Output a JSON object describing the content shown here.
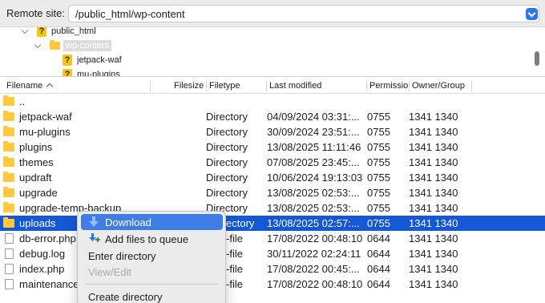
{
  "remote_site": {
    "label": "Remote site:",
    "path": "/public_html/wp-content"
  },
  "tree": {
    "items": [
      {
        "label": "public_html"
      },
      {
        "label": "wp-content"
      },
      {
        "label": "jetpack-waf"
      },
      {
        "label": "mu-plugins"
      }
    ]
  },
  "columns": {
    "filename": "Filename",
    "filesize": "Filesize",
    "filetype": "Filetype",
    "last_modified": "Last modified",
    "permissions": "Permissio",
    "owner_group": "Owner/Group"
  },
  "files": [
    {
      "name": "..",
      "type": "",
      "modified": "",
      "perm": "",
      "owner": ""
    },
    {
      "name": "jetpack-waf",
      "type": "Directory",
      "modified": "04/09/2024 03:31:...",
      "perm": "0755",
      "owner": "1341 1340"
    },
    {
      "name": "mu-plugins",
      "type": "Directory",
      "modified": "30/09/2024 23:51:...",
      "perm": "0755",
      "owner": "1341 1340"
    },
    {
      "name": "plugins",
      "type": "Directory",
      "modified": "13/08/2025 11:11:46",
      "perm": "0755",
      "owner": "1341 1340"
    },
    {
      "name": "themes",
      "type": "Directory",
      "modified": "07/08/2025 23:45:...",
      "perm": "0755",
      "owner": "1341 1340"
    },
    {
      "name": "updraft",
      "type": "Directory",
      "modified": "10/06/2024 19:13:03",
      "perm": "0755",
      "owner": "1341 1340"
    },
    {
      "name": "upgrade",
      "type": "Directory",
      "modified": "13/08/2025 02:53:...",
      "perm": "0755",
      "owner": "1341 1340"
    },
    {
      "name": "upgrade-temp-backup",
      "type": "Directory",
      "modified": "13/08/2025 02:53:...",
      "perm": "0755",
      "owner": "1341 1340"
    },
    {
      "name": "uploads",
      "type": "ectory",
      "modified": "13/08/2025 02:57:...",
      "perm": "0755",
      "owner": "1341 1340"
    },
    {
      "name": "db-error.php",
      "type": "-file",
      "modified": "17/08/2022 00:48:10",
      "perm": "0644",
      "owner": "1341 1340"
    },
    {
      "name": "debug.log",
      "type": "-file",
      "modified": "30/11/2022 02:24:11",
      "perm": "0644",
      "owner": "1341 1340"
    },
    {
      "name": "index.php",
      "type": "-file",
      "modified": "17/08/2022 00:45:...",
      "perm": "0644",
      "owner": "1341 1340"
    },
    {
      "name": "maintenance",
      "type": "-file",
      "modified": "17/08/2022 00:48:10",
      "perm": "0644",
      "owner": "1341 1340"
    }
  ],
  "context_menu": {
    "download": "Download",
    "add_to_queue": "Add files to queue",
    "enter_directory": "Enter directory",
    "view_edit": "View/Edit",
    "create_directory": "Create directory"
  },
  "colors": {
    "selection": "#1558d6",
    "menu_highlight": "#3d7de5",
    "folder": "#ffc83d"
  }
}
